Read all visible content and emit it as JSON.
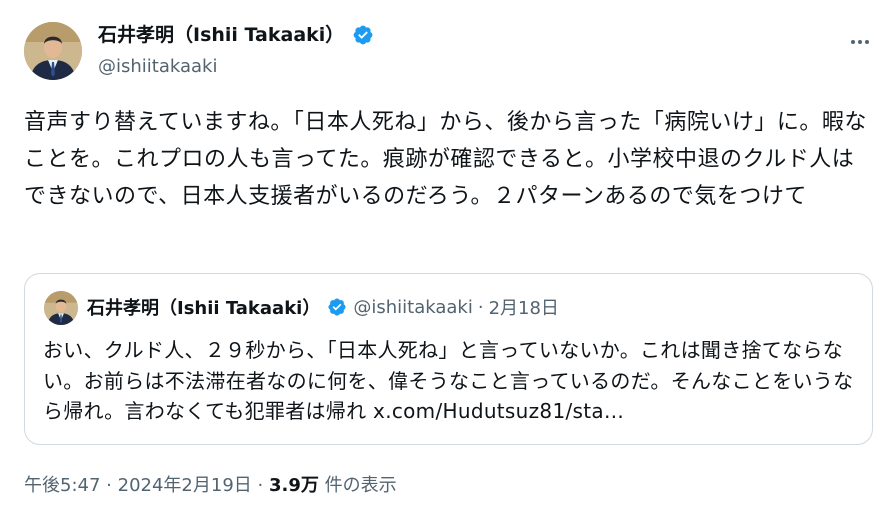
{
  "author": {
    "name": "石井孝明（Ishii Takaaki）",
    "handle": "@ishiitakaaki"
  },
  "tweet": {
    "text": "音声すり替えていますね。「日本人死ね」から、後から言った「病院いけ」に。暇なことを。これプロの人も言ってた。痕跡が確認できると。小学校中退のクルド人はできないので、日本人支援者がいるのだろう。２パターンあるので気をつけて"
  },
  "quote": {
    "name": "石井孝明（Ishii Takaaki）",
    "handle": "@ishiitakaaki",
    "separator": "·",
    "date": "2月18日",
    "text": "おい、クルド人、２９秒から、「日本人死ね」と言っていないか。これは聞き捨てならない。お前らは不法滞在者なのに何を、偉そうなこと言っているのだ。そんなことをいうなら帰れ。言わなくても犯罪者は帰れ x.com/Hudutsuz81/sta…"
  },
  "meta": {
    "time": "午後5:47",
    "separator1": "·",
    "date": "2024年2月19日",
    "separator2": "·",
    "views": "3.9万",
    "views_label": "件の表示"
  },
  "icons": {
    "verified": "verified-badge-icon",
    "more": "more-options-icon"
  },
  "colors": {
    "verified": "#1d9bf0",
    "secondary_text": "#536471",
    "border": "#cfd9de"
  }
}
